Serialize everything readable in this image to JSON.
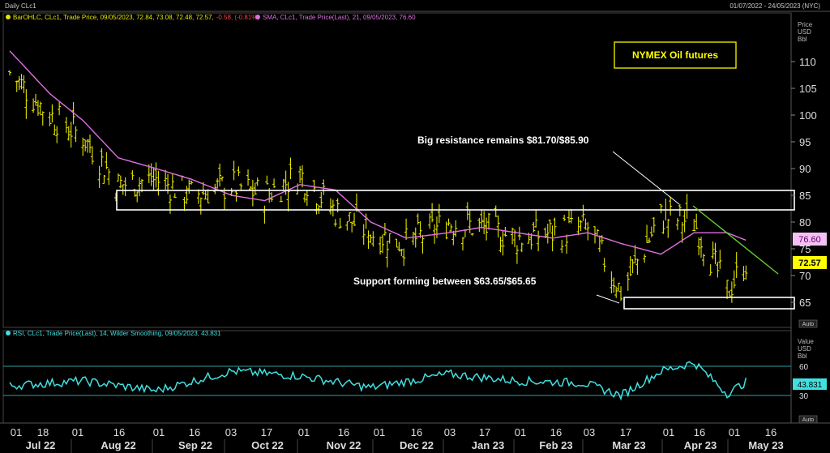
{
  "header": {
    "title": "Daily CLc1",
    "date_range": "01/07/2022 - 24/05/2023 (NYC)"
  },
  "legend": {
    "bar_text": "BarOHLC, CLc1, Trade Price, 09/05/2023, 72.84, 73.08, 72.48, 72.57,",
    "bar_change": "-0.58, (-0.81%)",
    "sma_text": "SMA, CLc1, Trade Price(Last), 21, 09/05/2023, 76.60",
    "rsi_text": "RSI, CLc1, Trade Price(Last), 14, Wilder Smoothing, 09/05/2023, 43.831"
  },
  "annotations": {
    "title_box": "NYMEX Oil futures",
    "resistance": "Big resistance remains $81.70/$85.90",
    "support": "Support forming between $63.65/$65.65"
  },
  "axis": {
    "price_header": [
      "Price",
      "USD",
      "Bbl"
    ],
    "rsi_header": [
      "Value",
      "USD",
      "Bbl"
    ],
    "auto_label": "Auto",
    "last_sma": "76.60",
    "last_price": "72.57",
    "last_rsi": "43.831",
    "days": [
      "01",
      "18",
      "01",
      "16",
      "01",
      "16",
      "03",
      "17",
      "01",
      "16",
      "01",
      "16",
      "03",
      "17",
      "01",
      "16",
      "03",
      "17",
      "01",
      "16"
    ],
    "months": [
      "Jul 22",
      "Aug 22",
      "Sep 22",
      "Oct 22",
      "Nov 22",
      "Dec 22",
      "Jan 23",
      "Feb 23",
      "Mar 23",
      "Apr 23",
      "May 23"
    ]
  },
  "colors": {
    "bars": "#e6e600",
    "sma": "#e070e0",
    "rsi": "#40e0e0",
    "rsi_levels": "#30a0a0",
    "trendline": "#66cc33",
    "annotation_box": "#ffffff",
    "last_price_bg": "#ffff00",
    "last_sma_bg": "#f5c0f5"
  },
  "chart_data": [
    {
      "type": "ohlc",
      "title": "Daily CLc1",
      "ylim": [
        62,
        120
      ],
      "yticks": [
        65,
        70,
        75,
        80,
        85,
        90,
        95,
        100,
        105,
        110
      ],
      "x_range": [
        "2022-07-01",
        "2023-05-24"
      ],
      "series": [
        {
          "name": "BarOHLC",
          "x": [
            "2022-07-01",
            "2022-07-18",
            "2022-08-01",
            "2022-08-16",
            "2022-09-01",
            "2022-09-16",
            "2022-10-03",
            "2022-10-17",
            "2022-11-01",
            "2022-11-16",
            "2022-12-01",
            "2022-12-16",
            "2023-01-03",
            "2023-01-17",
            "2023-02-01",
            "2023-02-16",
            "2023-03-03",
            "2023-03-17",
            "2023-04-03",
            "2023-04-17",
            "2023-05-01",
            "2023-05-09"
          ],
          "values": [
            108,
            100,
            96,
            87,
            88,
            85,
            87,
            85,
            89,
            82,
            78,
            76,
            80,
            79,
            77,
            78,
            79,
            67,
            81,
            80,
            67,
            72.57
          ]
        },
        {
          "name": "SMA 21",
          "x": [
            "2022-07-01",
            "2022-07-18",
            "2022-08-01",
            "2022-08-16",
            "2022-09-01",
            "2022-09-16",
            "2022-10-03",
            "2022-10-17",
            "2022-11-01",
            "2022-11-16",
            "2022-12-01",
            "2022-12-16",
            "2023-01-03",
            "2023-01-17",
            "2023-02-01",
            "2023-02-16",
            "2023-03-03",
            "2023-03-17",
            "2023-04-03",
            "2023-04-17",
            "2023-05-01",
            "2023-05-09"
          ],
          "values": [
            112,
            104,
            99,
            92,
            90,
            88,
            85,
            84,
            87,
            86,
            80,
            77,
            78,
            79,
            78,
            77,
            78,
            76,
            74,
            78,
            78,
            76.6
          ]
        }
      ],
      "annotations": [
        {
          "label": "Big resistance remains $81.70/$85.90",
          "range": [
            81.7,
            85.9
          ]
        },
        {
          "label": "Support forming between $63.65/$65.65",
          "range": [
            63.65,
            65.65
          ]
        }
      ]
    },
    {
      "type": "line",
      "title": "RSI",
      "ylim": [
        20,
        80
      ],
      "yticks": [
        30,
        60
      ],
      "series": [
        {
          "name": "RSI",
          "x": [
            "2022-07-01",
            "2022-08-01",
            "2022-09-01",
            "2022-10-03",
            "2022-11-01",
            "2022-12-01",
            "2023-01-03",
            "2023-02-01",
            "2023-03-01",
            "2023-03-17",
            "2023-04-03",
            "2023-04-17",
            "2023-05-01",
            "2023-05-09"
          ],
          "values": [
            40,
            45,
            35,
            55,
            50,
            38,
            52,
            45,
            43,
            30,
            55,
            64,
            32,
            43.831
          ]
        }
      ]
    }
  ]
}
